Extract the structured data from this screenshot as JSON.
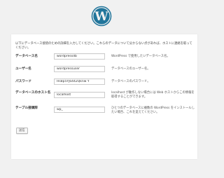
{
  "logo": {
    "icon": "wordpress-logo-icon",
    "color": "#21759b"
  },
  "intro": "以下にデータベース接続のための詳細を入力してください。これらのデータについて分からない点があれば、ホストに連絡を取ってください。",
  "rows": [
    {
      "label": "データベース名",
      "value": "wordpressdb",
      "help": "WordPress で使用したいデータベース名。"
    },
    {
      "label": "ユーザー名",
      "value": "wordpressuser",
      "help": "データベースのユーザー名。"
    },
    {
      "label": "パスワード",
      "value": "Hs8p5Yj6442Qknw Y",
      "help": "データベースのパスワード。"
    },
    {
      "label": "データベースのホスト名",
      "value": "localhost",
      "help": "localhost が動作しない場合には Web ホストからこの情報を取得することができます。"
    },
    {
      "label": "テーブル接頭辞",
      "value": "wp_",
      "help": "ひとつのデータベースに複数の WordPress をインストールしたい場合、これを変えてください。"
    }
  ],
  "submit_label": "送信"
}
